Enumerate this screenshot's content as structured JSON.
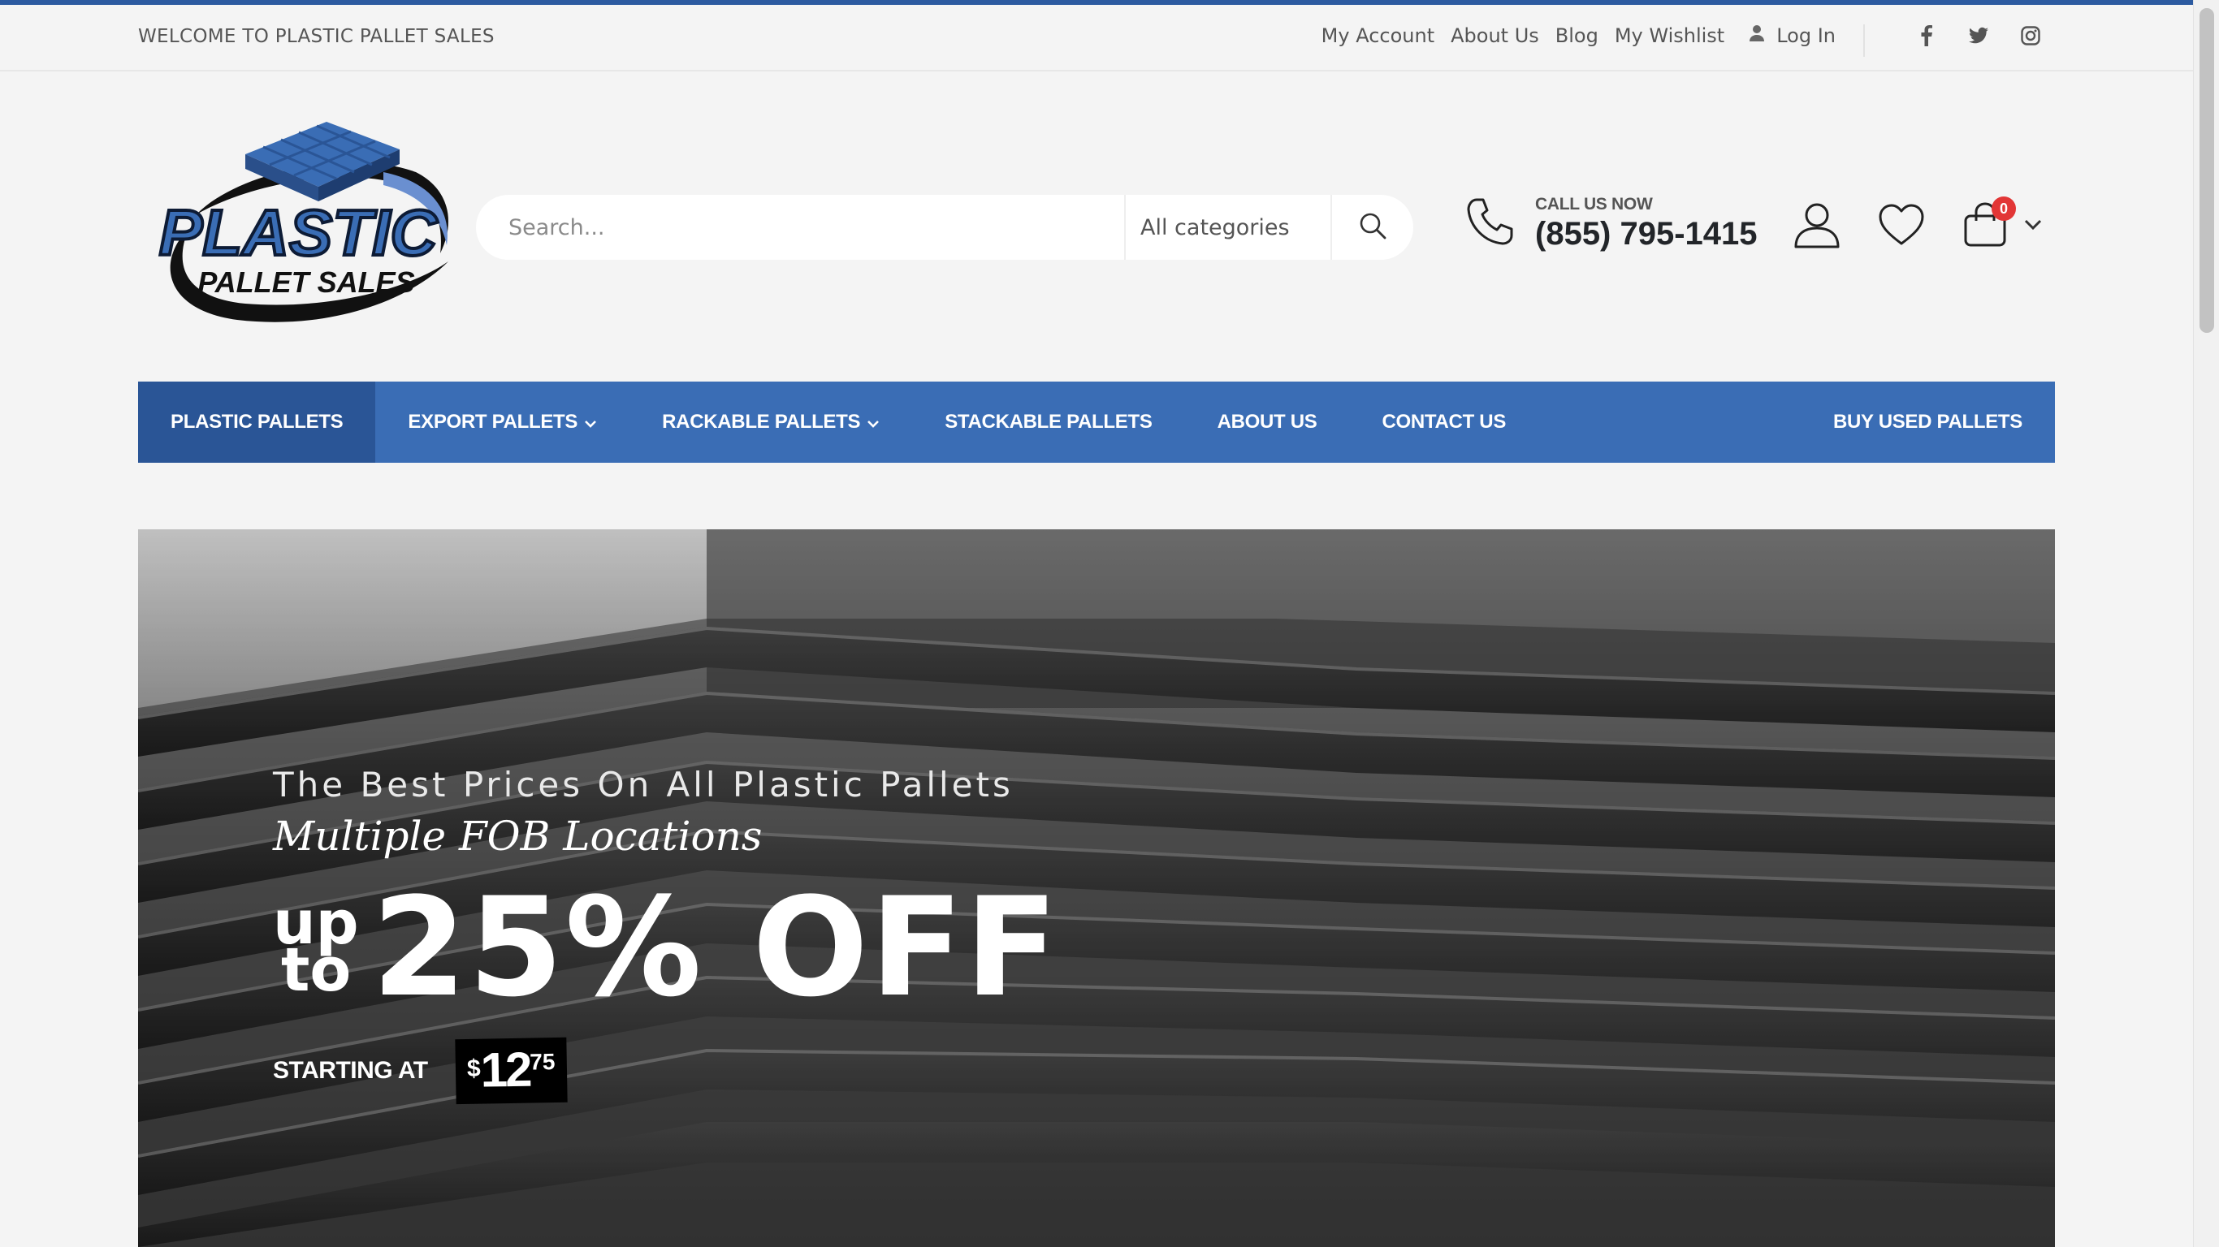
{
  "colors": {
    "accent": "#3a6db5",
    "accent_dark": "#2a5596",
    "top_accent": "#2c5aa0",
    "badge": "#e23636"
  },
  "topbar": {
    "welcome": "WELCOME TO PLASTIC PALLET SALES",
    "links": [
      "My Account",
      "About Us",
      "Blog",
      "My Wishlist"
    ],
    "login": "Log In",
    "social": [
      "facebook-icon",
      "twitter-icon",
      "instagram-icon"
    ]
  },
  "logo": {
    "line1": "PLASTIC",
    "line2": "PALLET SALES"
  },
  "search": {
    "placeholder": "Search...",
    "category": "All categories"
  },
  "contact": {
    "label": "CALL US NOW",
    "phone": "(855) 795-1415"
  },
  "cart": {
    "count": "0"
  },
  "nav": {
    "items": [
      {
        "label": "PLASTIC PALLETS"
      },
      {
        "label": "EXPORT PALLETS"
      },
      {
        "label": "RACKABLE PALLETS"
      },
      {
        "label": "STACKABLE PALLETS"
      },
      {
        "label": "ABOUT US"
      },
      {
        "label": "CONTACT US"
      }
    ],
    "right": "BUY USED PALLETS"
  },
  "hero": {
    "line1": "The Best Prices On All Plastic Pallets",
    "line2": "Multiple FOB Locations",
    "up": "up",
    "to": "to",
    "discount": "25% OFF",
    "starting": "STARTING AT",
    "currency": "$",
    "price_int": "12",
    "price_dec": "75"
  }
}
